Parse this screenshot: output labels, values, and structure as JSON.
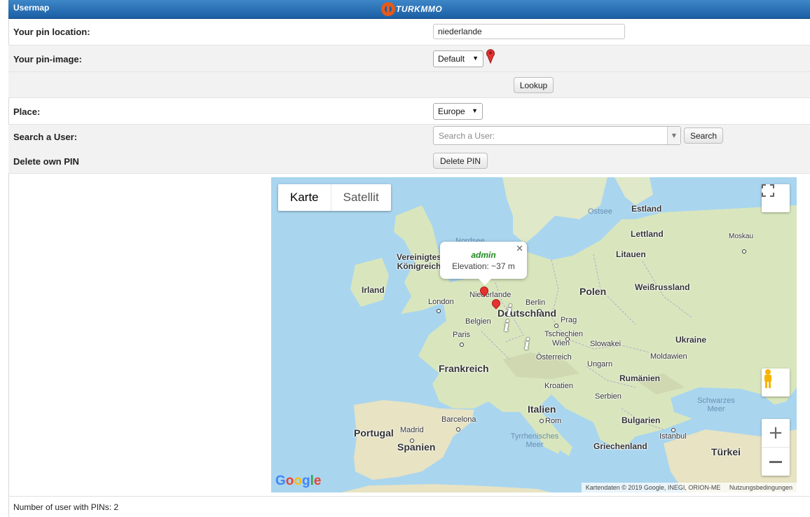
{
  "header": {
    "title": "Usermap",
    "logo_text": "TURKMMO"
  },
  "form": {
    "pin_location": {
      "label": "Your pin location:",
      "value": "niederlande"
    },
    "pin_image": {
      "label": "Your pin-image:",
      "selected": "Default"
    },
    "lookup_button": "Lookup",
    "place": {
      "label": "Place:",
      "selected": "Europe"
    },
    "search_user": {
      "label": "Search a User:",
      "placeholder": "Search a User:",
      "button": "Search"
    },
    "delete_pin": {
      "label": "Delete own PIN",
      "button": "Delete PIN"
    }
  },
  "map": {
    "type_buttons": [
      "Karte",
      "Satellit"
    ],
    "active_type": "Karte",
    "infowindow": {
      "user": "admin",
      "elevation": "Elevation: ~37 m"
    },
    "countries": [
      "Estland",
      "Lettland",
      "Litauen",
      "Vereinigtes Königreich",
      "Irland",
      "Niederlande",
      "Deutschland",
      "Belgien",
      "Polen",
      "Weißrussland",
      "Frankreich",
      "Tschechien",
      "Slowakei",
      "Österreich",
      "Ungarn",
      "Ukraine",
      "Moldawien",
      "Rumänien",
      "Kroatien",
      "Serbien",
      "Italien",
      "Bulgarien",
      "Portugal",
      "Spanien",
      "Griechenland",
      "Türkei"
    ],
    "cities": [
      "Moskau",
      "London",
      "Berlin",
      "Paris",
      "Prag",
      "Wien",
      "Barcelona",
      "Rom",
      "Madrid",
      "Istanbul"
    ],
    "seas": [
      "Ostsee",
      "Nordsee",
      "Schwarzes Meer",
      "Tyrrhenisches Meer"
    ],
    "attribution": "Kartendaten © 2019 Google, INEGI, ORION-ME",
    "terms": "Nutzungsbedingungen",
    "google": "Google"
  },
  "footer": {
    "text": "Number of user with PINs: 2"
  }
}
